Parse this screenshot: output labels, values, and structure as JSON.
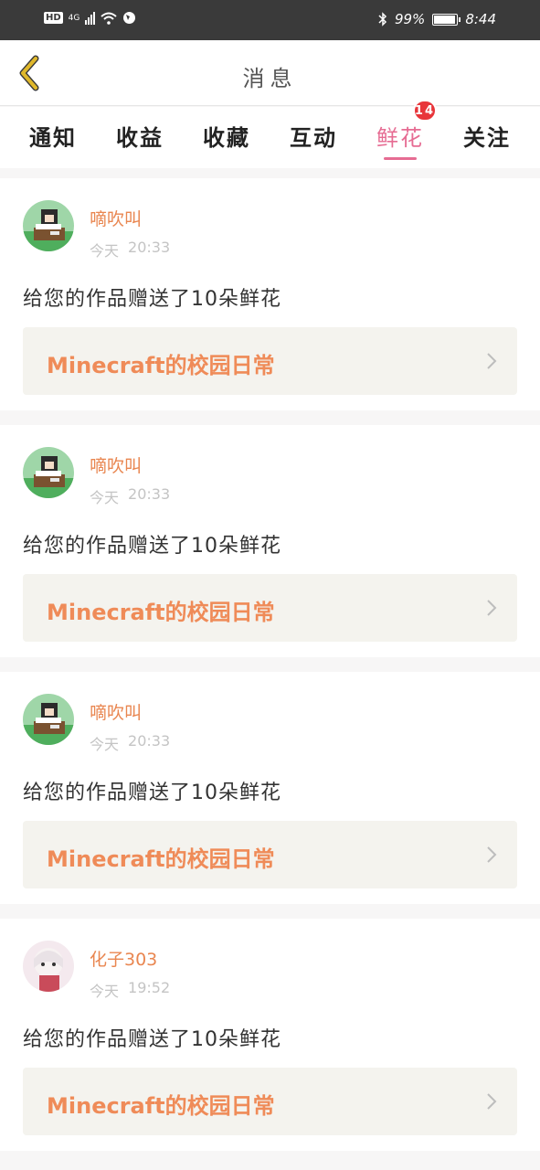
{
  "status_bar": {
    "hd": "HD",
    "network": "4G",
    "battery_text": "99%",
    "battery_level": 0.99,
    "time": "8:44"
  },
  "header": {
    "title": "消息",
    "back_icon": "chevron-left-icon",
    "back_color": "#e0b82b"
  },
  "tabs": [
    {
      "label": "通知",
      "active": false
    },
    {
      "label": "收益",
      "active": false
    },
    {
      "label": "收藏",
      "active": false
    },
    {
      "label": "互动",
      "active": false
    },
    {
      "label": "鲜花",
      "active": true,
      "badge": "14"
    },
    {
      "label": "关注",
      "active": false
    }
  ],
  "messages": [
    {
      "user": "嘀吹叫",
      "day": "今天",
      "time": "20:33",
      "text": "给您的作品赠送了10朵鲜花",
      "work": "Minecraft的校园日常",
      "avatar": "minecraft-avatar"
    },
    {
      "user": "嘀吹叫",
      "day": "今天",
      "time": "20:33",
      "text": "给您的作品赠送了10朵鲜花",
      "work": "Minecraft的校园日常",
      "avatar": "minecraft-avatar"
    },
    {
      "user": "嘀吹叫",
      "day": "今天",
      "time": "20:33",
      "text": "给您的作品赠送了10朵鲜花",
      "work": "Minecraft的校园日常",
      "avatar": "minecraft-avatar"
    },
    {
      "user": "化子303",
      "day": "今天",
      "time": "19:52",
      "text": "给您的作品赠送了10朵鲜花",
      "work": "Minecraft的校园日常",
      "avatar": "anime-avatar"
    }
  ],
  "colors": {
    "accent": "#e66c93",
    "badge": "#e8353a",
    "username": "#e98650",
    "work_title": "#ef8b58"
  }
}
